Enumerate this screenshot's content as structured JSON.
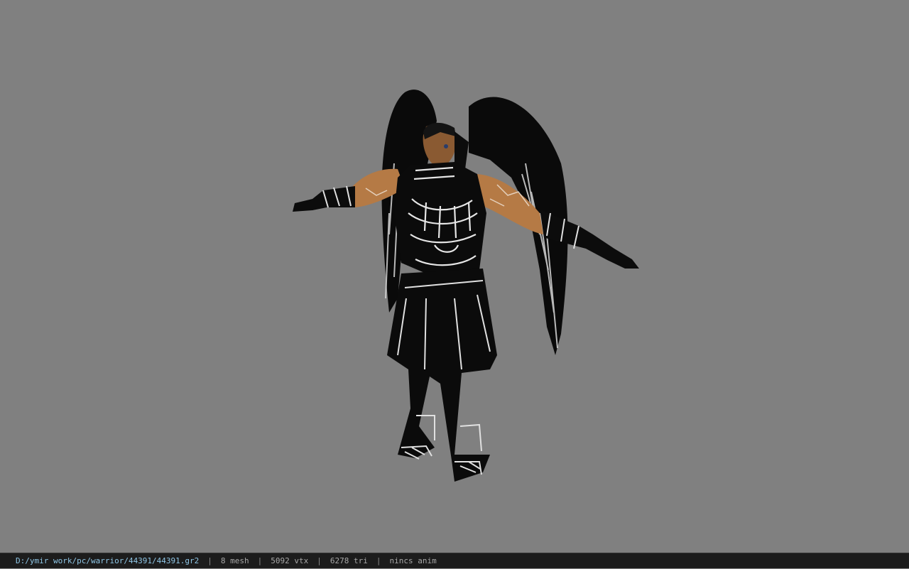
{
  "viewer": {
    "background_color": "#808080",
    "model_name": "warrior-winged-armor-model"
  },
  "statusbar": {
    "file_path": "D:/ymir work/pc/warrior/44391/44391.gr2",
    "separator": "|",
    "mesh_count": "8 mesh",
    "vertex_count": "5092 vtx",
    "triangle_count": "6278 tri",
    "anim_status": "nincs anim",
    "background_color": "#1c1c1c",
    "path_color": "#8fc6e6"
  }
}
